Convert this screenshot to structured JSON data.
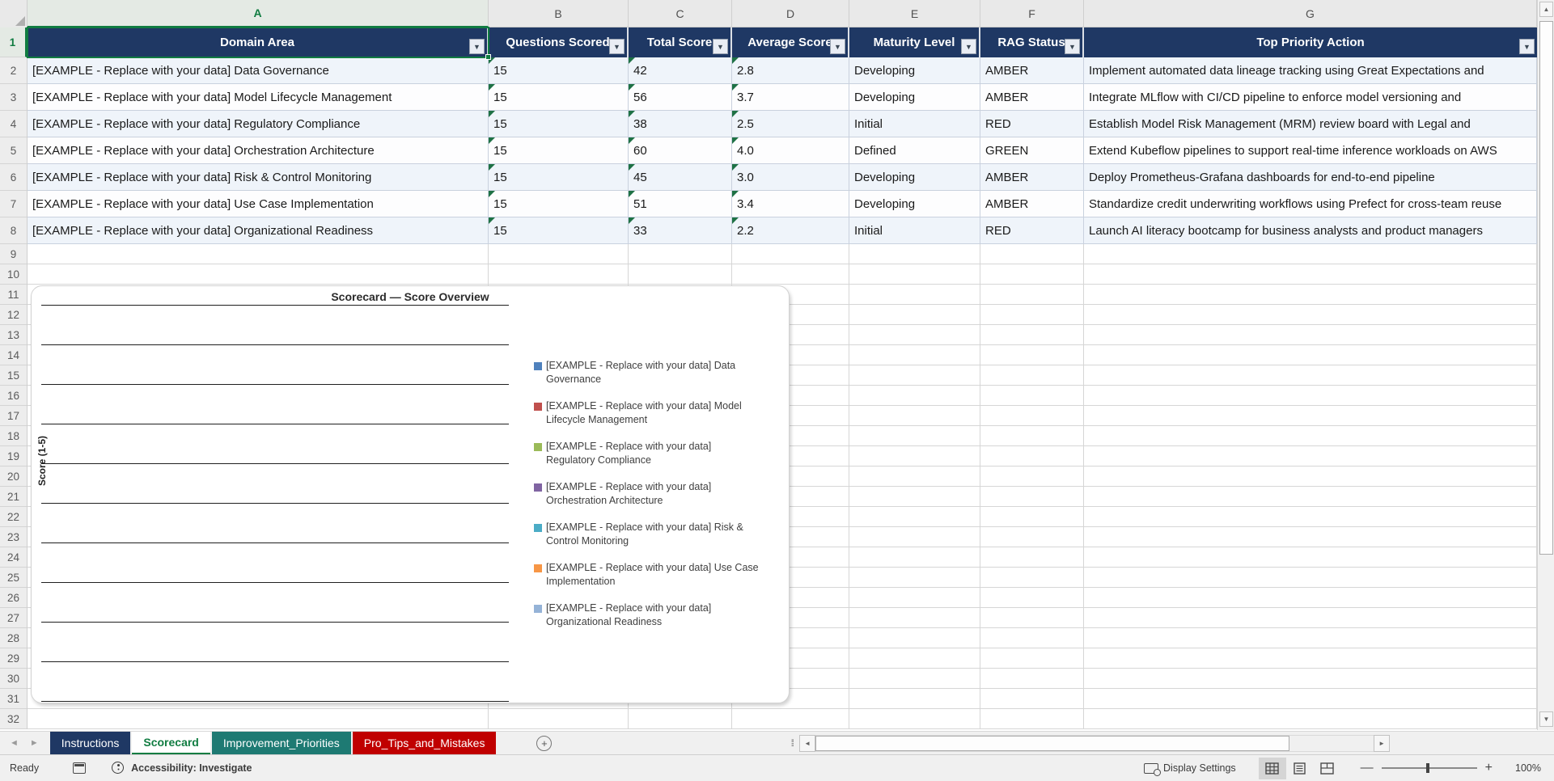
{
  "columns": {
    "letters": [
      "A",
      "B",
      "C",
      "D",
      "E",
      "F",
      "G"
    ],
    "selected": "A"
  },
  "rows": {
    "first_visible": 1,
    "last_visible": 32,
    "selected_row": "1"
  },
  "table": {
    "header_bg": "#1F3864",
    "headers": [
      "Domain Area",
      "Questions Scored",
      "Total Score",
      "Average Score",
      "Maturity Level",
      "RAG Status",
      "Top Priority Action"
    ],
    "rows": [
      [
        "[EXAMPLE - Replace with your data] Data Governance",
        "15",
        "42",
        "2.8",
        "Developing",
        "AMBER",
        "Implement automated data lineage tracking using Great Expectations and"
      ],
      [
        "[EXAMPLE - Replace with your data] Model Lifecycle Management",
        "15",
        "56",
        "3.7",
        "Developing",
        "AMBER",
        "Integrate MLflow with CI/CD pipeline to enforce model versioning and"
      ],
      [
        "[EXAMPLE - Replace with your data] Regulatory Compliance",
        "15",
        "38",
        "2.5",
        "Initial",
        "RED",
        "Establish Model Risk Management (MRM) review board with Legal and"
      ],
      [
        "[EXAMPLE - Replace with your data] Orchestration Architecture",
        "15",
        "60",
        "4.0",
        "Defined",
        "GREEN",
        "Extend Kubeflow pipelines to support real-time inference workloads on AWS"
      ],
      [
        "[EXAMPLE - Replace with your data] Risk & Control Monitoring",
        "15",
        "45",
        "3.0",
        "Developing",
        "AMBER",
        "Deploy Prometheus-Grafana dashboards for end-to-end pipeline"
      ],
      [
        "[EXAMPLE - Replace with your data] Use Case Implementation",
        "15",
        "51",
        "3.4",
        "Developing",
        "AMBER",
        "Standardize credit underwriting workflows using Prefect for cross-team reuse"
      ],
      [
        "[EXAMPLE - Replace with your data] Organizational Readiness",
        "15",
        "33",
        "2.2",
        "Initial",
        "RED",
        "Launch AI literacy bootcamp for business analysts and product managers"
      ]
    ]
  },
  "chart": {
    "type": "column",
    "title": "Scorecard — Score Overview",
    "y_axis_label": "Score (1-5)",
    "gridline_count": 11,
    "legend": [
      {
        "label": "[EXAMPLE - Replace with your data] Data Governance",
        "color": "#4F81BD"
      },
      {
        "label": "[EXAMPLE - Replace with your data] Model Lifecycle Management",
        "color": "#C0504D"
      },
      {
        "label": "[EXAMPLE - Replace with your data] Regulatory Compliance",
        "color": "#9BBB59"
      },
      {
        "label": "[EXAMPLE - Replace with your data] Orchestration Architecture",
        "color": "#8064A2"
      },
      {
        "label": "[EXAMPLE - Replace with your data] Risk & Control Monitoring",
        "color": "#4BACC6"
      },
      {
        "label": "[EXAMPLE - Replace with your data] Use Case Implementation",
        "color": "#F79646"
      },
      {
        "label": "[EXAMPLE - Replace with your data] Organizational Readiness",
        "color": "#95B3D7"
      }
    ]
  },
  "sheet_tabs": {
    "tabs": [
      {
        "label": "Instructions",
        "bg": "#1F3864",
        "fg": "#FFFFFF",
        "active": false
      },
      {
        "label": "Scorecard",
        "bg": "#FFFFFF",
        "fg": "#107C41",
        "active": true
      },
      {
        "label": "Improvement_Priorities",
        "bg": "#1E7A73",
        "fg": "#FFFFFF",
        "active": false
      },
      {
        "label": "Pro_Tips_and_Mistakes",
        "bg": "#C00000",
        "fg": "#FFFFFF",
        "active": false
      }
    ],
    "add_label": "+"
  },
  "status_bar": {
    "mode": "Ready",
    "accessibility": "Accessibility: Investigate",
    "display_settings": "Display Settings",
    "zoom_level": "100%",
    "zoom_out": "—",
    "zoom_in": "+"
  },
  "accent": {
    "selection_green": "#107C41"
  }
}
